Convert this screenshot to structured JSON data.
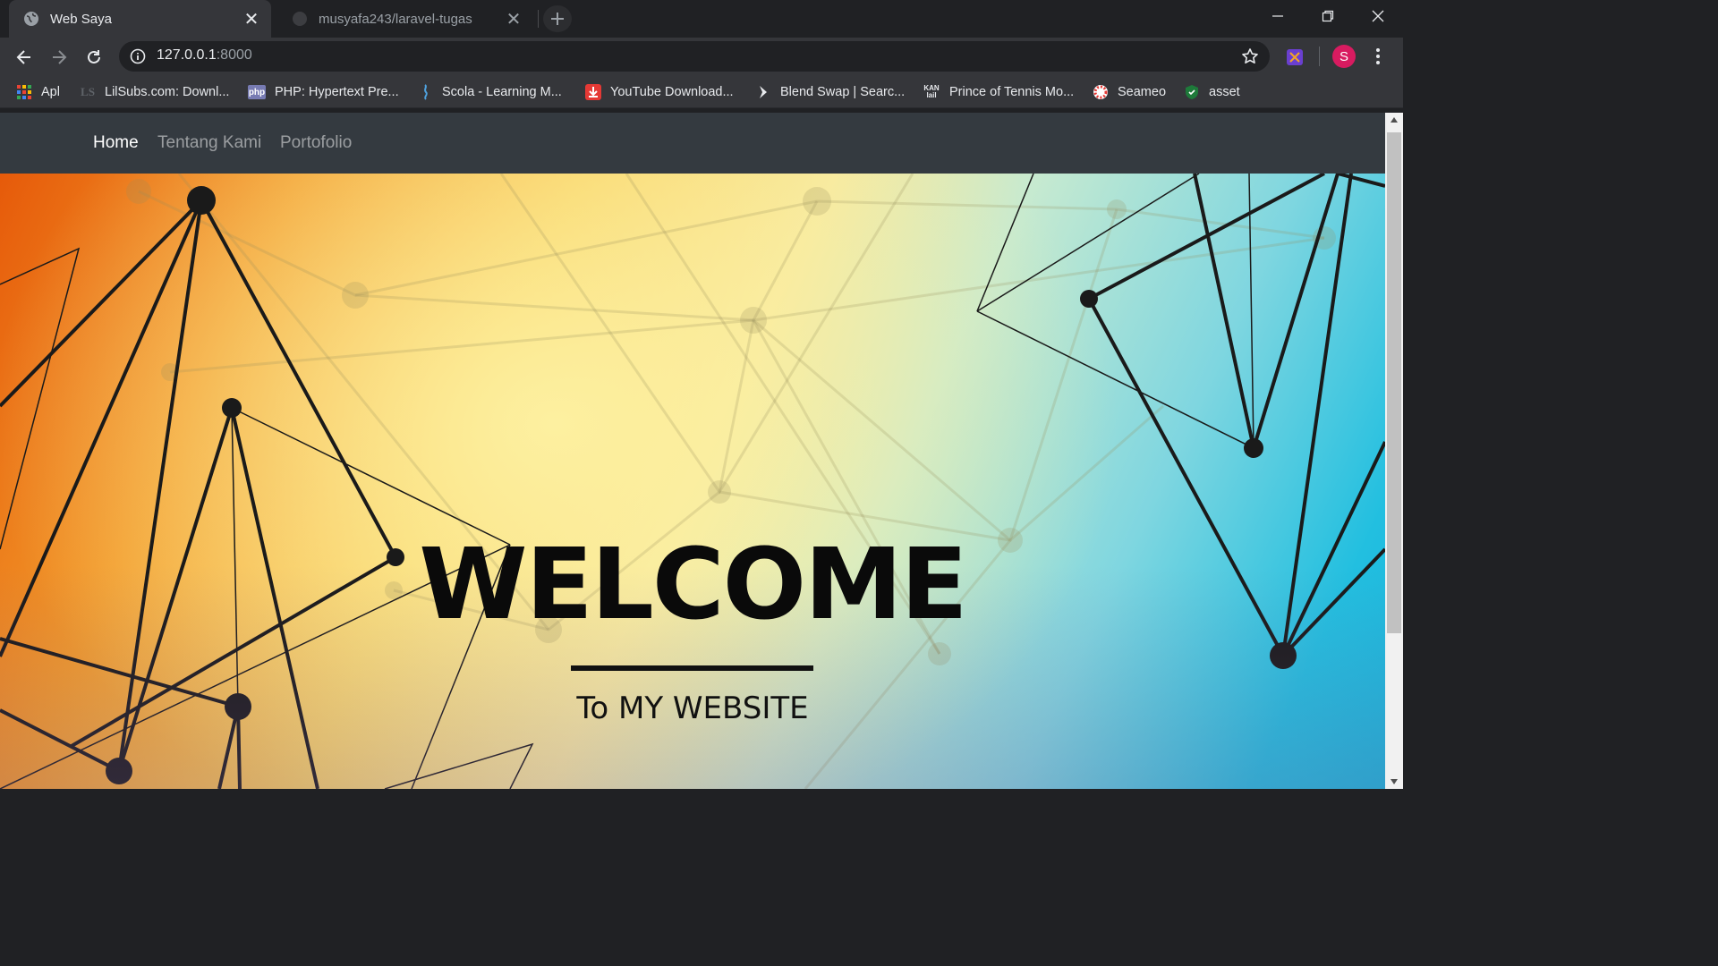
{
  "browser": {
    "tabs": [
      {
        "title": "Web Saya",
        "active": true
      },
      {
        "title": "musyafa243/laravel-tugas",
        "active": false
      }
    ],
    "url_host": "127.0.0.1",
    "url_port": ":8000",
    "profile_initial": "S",
    "bookmarks": [
      {
        "label": "Apl",
        "icon": "apps-grid-icon"
      },
      {
        "label": "LilSubs.com: Downl...",
        "icon": "lilsubs-icon"
      },
      {
        "label": "PHP: Hypertext Pre...",
        "icon": "php-icon"
      },
      {
        "label": "Scola - Learning M...",
        "icon": "scola-icon"
      },
      {
        "label": "YouTube Download...",
        "icon": "download-icon"
      },
      {
        "label": "Blend Swap | Searc...",
        "icon": "blendswap-icon"
      },
      {
        "label": "Prince of Tennis Mo...",
        "icon": "kan-icon"
      },
      {
        "label": "Seameo",
        "icon": "seameo-icon"
      },
      {
        "label": "asset",
        "icon": "shield-icon"
      }
    ]
  },
  "site": {
    "nav": [
      {
        "label": "Home",
        "active": true
      },
      {
        "label": "Tentang Kami",
        "active": false
      },
      {
        "label": "Portofolio",
        "active": false
      }
    ],
    "hero": {
      "title": "WELCOME",
      "subtitle": "To MY WEBSITE"
    }
  },
  "colors": {
    "tab_bar": "#202124",
    "toolbar": "#35363a",
    "site_nav": "#343a40",
    "profile": "#d81b60"
  }
}
